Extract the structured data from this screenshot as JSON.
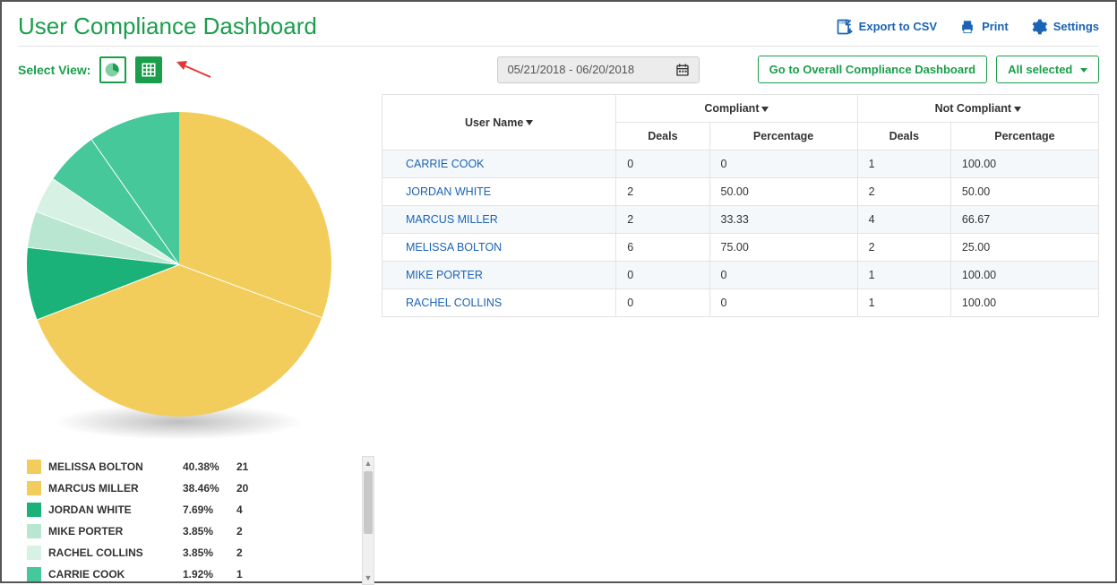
{
  "header": {
    "title": "User Compliance Dashboard",
    "actions": {
      "export": "Export to CSV",
      "print": "Print",
      "settings": "Settings"
    }
  },
  "controls": {
    "select_view_label": "Select View:",
    "date_range": "05/21/2018 - 06/20/2018",
    "goto_dashboard": "Go to Overall Compliance Dashboard",
    "filter_label": "All selected"
  },
  "table": {
    "headers": {
      "user": "User Name",
      "compliant": "Compliant",
      "not_compliant": "Not Compliant",
      "deals": "Deals",
      "percentage": "Percentage"
    },
    "rows": [
      {
        "name": "CARRIE COOK",
        "c_deals": "0",
        "c_pct": "0",
        "nc_deals": "1",
        "nc_pct": "100.00"
      },
      {
        "name": "JORDAN WHITE",
        "c_deals": "2",
        "c_pct": "50.00",
        "nc_deals": "2",
        "nc_pct": "50.00"
      },
      {
        "name": "MARCUS MILLER",
        "c_deals": "2",
        "c_pct": "33.33",
        "nc_deals": "4",
        "nc_pct": "66.67"
      },
      {
        "name": "MELISSA BOLTON",
        "c_deals": "6",
        "c_pct": "75.00",
        "nc_deals": "2",
        "nc_pct": "25.00"
      },
      {
        "name": "MIKE PORTER",
        "c_deals": "0",
        "c_pct": "0",
        "nc_deals": "1",
        "nc_pct": "100.00"
      },
      {
        "name": "RACHEL COLLINS",
        "c_deals": "0",
        "c_pct": "0",
        "nc_deals": "1",
        "nc_pct": "100.00"
      }
    ]
  },
  "chart_data": {
    "type": "pie",
    "title": "",
    "series": [
      {
        "name": "MELISSA BOLTON",
        "pct": 40.38,
        "count": 21,
        "color": "#f3cd5b",
        "pct_str": "40.38%"
      },
      {
        "name": "MARCUS MILLER",
        "pct": 38.46,
        "count": 20,
        "color": "#f3cd5b",
        "pct_str": "38.46%"
      },
      {
        "name": "JORDAN WHITE",
        "pct": 7.69,
        "count": 4,
        "color": "#1bb27a",
        "pct_str": "7.69%"
      },
      {
        "name": "MIKE PORTER",
        "pct": 3.85,
        "count": 2,
        "color": "#b8e6d0",
        "pct_str": "3.85%"
      },
      {
        "name": "RACHEL COLLINS",
        "pct": 3.85,
        "count": 2,
        "color": "#d7f1e4",
        "pct_str": "3.85%"
      },
      {
        "name": "CARRIE COOK",
        "pct": 1.92,
        "count": 1,
        "color": "#46c89a",
        "pct_str": "1.92%"
      }
    ]
  }
}
